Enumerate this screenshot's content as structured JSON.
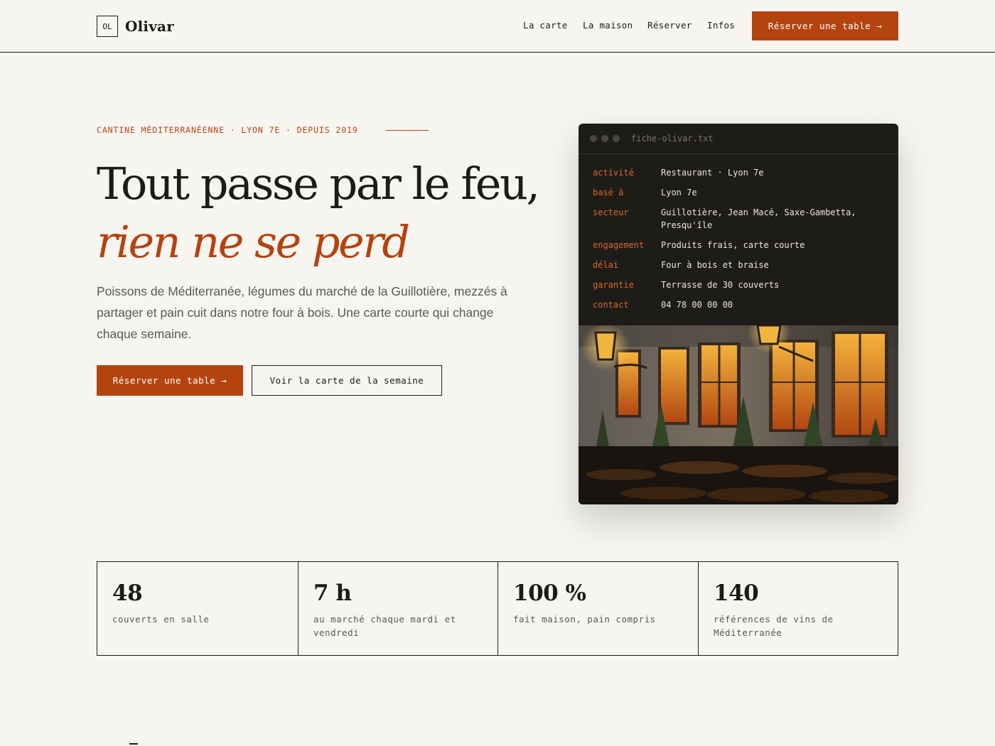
{
  "header": {
    "logo_mark": "OL",
    "logo_name": "Olivar",
    "nav": [
      "La carte",
      "La maison",
      "Réserver",
      "Infos"
    ],
    "cta": "Réserver une table →"
  },
  "hero": {
    "eyebrow": "CANTINE MÉDITERRANÉENNE · LYON 7E · DEPUIS 2019",
    "headline_main": "Tout passe par le feu,",
    "headline_accent": "rien ne se perd",
    "lede": "Poissons de Méditerranée, légumes du marché de la Guillotière, mezzés à partager et pain cuit dans notre four à bois. Une carte courte qui change chaque semaine.",
    "primary_button": "Réserver une table →",
    "secondary_button": "Voir la carte de la semaine"
  },
  "card": {
    "filename": "fiche-olivar.txt",
    "rows": [
      {
        "key": "activité",
        "value": "Restaurant · Lyon 7e"
      },
      {
        "key": "basé à",
        "value": "Lyon 7e"
      },
      {
        "key": "secteur",
        "value": "Guillotière, Jean Macé, Saxe-Gambetta, Presqu'île"
      },
      {
        "key": "engagement",
        "value": "Produits frais, carte courte"
      },
      {
        "key": "délai",
        "value": "Four à bois et braise"
      },
      {
        "key": "garantie",
        "value": "Terrasse de 30 couverts"
      },
      {
        "key": "contact",
        "value": "04 78 00 00 00"
      }
    ]
  },
  "stats": [
    {
      "value": "48",
      "label": "couverts en salle"
    },
    {
      "value": "7 h",
      "label": "au marché chaque mardi et vendredi"
    },
    {
      "value": "100 %",
      "label": "fait maison, pain compris"
    },
    {
      "value": "140",
      "label": "références de vins de Méditerranée"
    }
  ],
  "colors": {
    "accent": "#b5430f",
    "ink": "#1c1b18",
    "paper": "#f7f5f0",
    "card_bg": "#1e1c18",
    "card_key": "#d8692c"
  }
}
